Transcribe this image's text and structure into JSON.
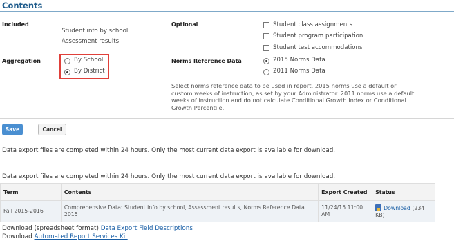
{
  "header": {
    "title": "Contents"
  },
  "included": {
    "label": "Included",
    "items": [
      "Student info by school",
      "Assessment results"
    ]
  },
  "optional": {
    "label": "Optional",
    "items": [
      "Student class assignments",
      "Student program participation",
      "Student test accommodations"
    ]
  },
  "aggregation": {
    "label": "Aggregation",
    "options": [
      {
        "label": "By School",
        "selected": false
      },
      {
        "label": "By District",
        "selected": true
      }
    ]
  },
  "norms": {
    "label": "Norms Reference Data",
    "options": [
      {
        "label": "2015 Norms Data",
        "selected": true
      },
      {
        "label": "2011 Norms Data",
        "selected": false
      }
    ],
    "help_lines": [
      "Select norms reference data to be used in report. 2015 norms use a default or",
      "custom weeks of instruction, as set by your Administrator. 2011 norms use a default",
      "weeks of instruction and do not calculate Conditional Growth Index or Conditional",
      "Growth Percentile."
    ]
  },
  "buttons": {
    "save": "Save",
    "cancel": "Cancel"
  },
  "notes": {
    "first": "Data export files are completed within 24 hours. Only the most current data export is available for download.",
    "second": "Data export files are completed within 24 hours. Only the most current data export is available for download."
  },
  "table": {
    "headers": [
      "Term",
      "Contents",
      "Export Created",
      "Status"
    ],
    "rows": [
      {
        "term": "Fall 2015-2016",
        "contents_lines": [
          "Comprehensive Data: Student info by school, Assessment results, Norms Reference Data",
          "2015"
        ],
        "created_lines": [
          "11/24/15 11:00",
          "AM"
        ],
        "status_link": "Download",
        "status_size": "(234 KB)"
      }
    ]
  },
  "footer": {
    "line1_prefix": "Download (spreadsheet format) ",
    "line1_link": "Data Export Field Descriptions",
    "line2_prefix": "Download ",
    "line2_link": "Automated Report Services Kit"
  },
  "colors": {
    "accent": "#1f5c8c",
    "save_button": "#4a8fd1",
    "highlight_box": "#e0403a",
    "link": "#1a5fa6"
  }
}
